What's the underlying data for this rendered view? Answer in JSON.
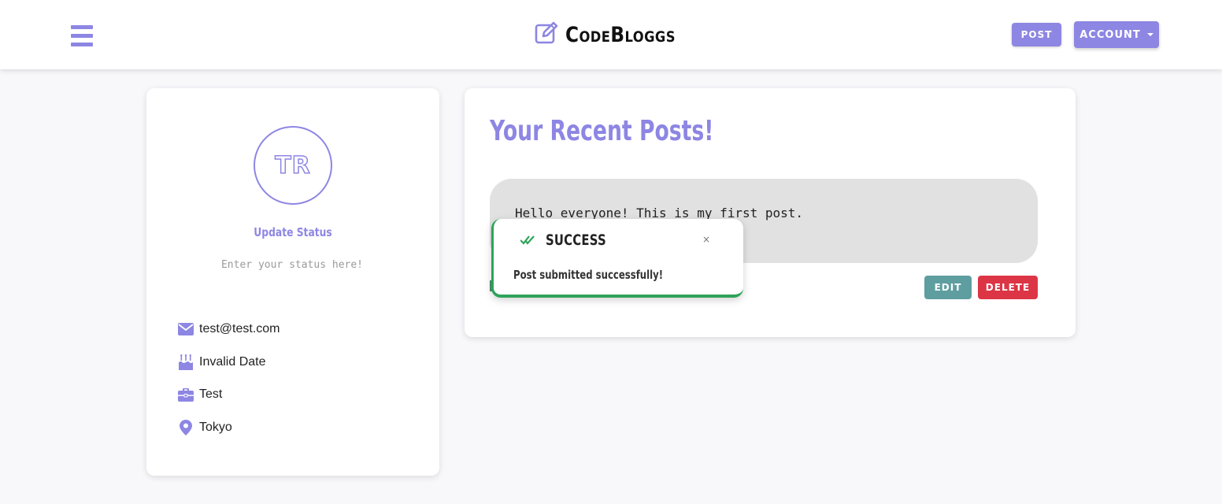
{
  "colors": {
    "accent": "#8d86e3",
    "success": "#2ea35a",
    "edit": "#5f9ea0",
    "delete": "#dc3545",
    "bubble": "#e1e1e1"
  },
  "navbar": {
    "menu_icon": "hamburger-icon",
    "brand_icon": "edit-square-icon",
    "brand": "CodeBloggs",
    "post_label": "POST",
    "account_label": "ACCOUNT"
  },
  "profile": {
    "initials": "TR",
    "update_status_label": "Update Status",
    "status_placeholder": "Enter your status here!",
    "info": [
      {
        "icon": "envelope-icon",
        "text": "test@test.com"
      },
      {
        "icon": "birthday-cake-icon",
        "text": "Invalid Date"
      },
      {
        "icon": "briefcase-icon",
        "text": "Test"
      },
      {
        "icon": "map-marker-icon",
        "text": "Tokyo"
      }
    ]
  },
  "posts": {
    "title": "Your Recent Posts!",
    "items": [
      {
        "content": "Hello everyone! This is my first post.",
        "edit_label": "EDIT",
        "delete_label": "DELETE"
      }
    ]
  },
  "toast": {
    "icon": "double-check-icon",
    "title": "SUCCESS",
    "close": "×",
    "message": "Post submitted successfully!"
  }
}
